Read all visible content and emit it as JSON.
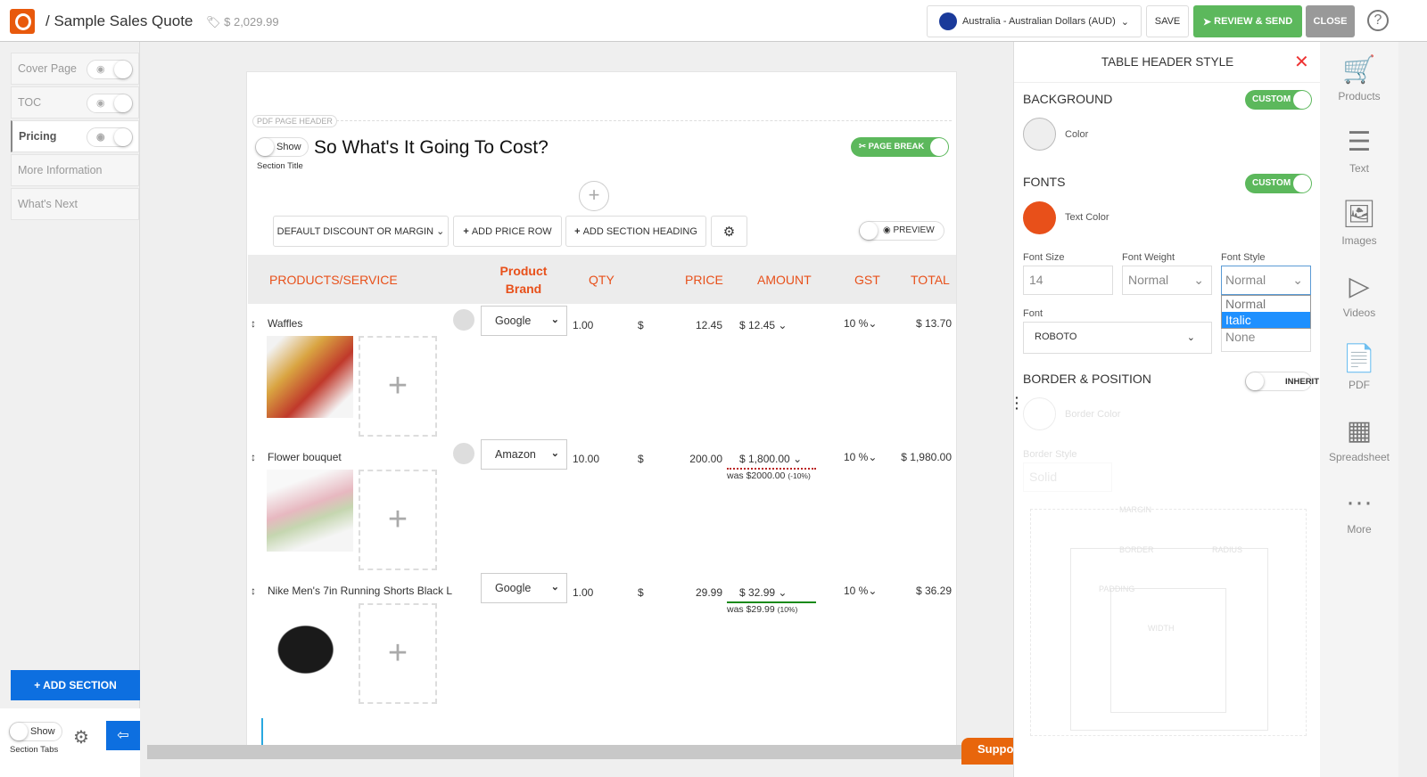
{
  "header": {
    "title": "/ Sample Sales Quote",
    "quote_total": "$ 2,029.99",
    "currency": "Australia - Australian Dollars (AUD)",
    "save": "SAVE",
    "review_send": "REVIEW & SEND",
    "close": "CLOSE",
    "help": "?"
  },
  "sidebar": {
    "items": [
      {
        "label": "Cover Page",
        "toggle": true
      },
      {
        "label": "TOC",
        "toggle": true
      },
      {
        "label": "Pricing",
        "toggle": true,
        "active": true
      },
      {
        "label": "More Information"
      },
      {
        "label": "What's Next"
      }
    ],
    "add_section": "+ ADD SECTION",
    "show": "Show",
    "section_tabs": "Section Tabs"
  },
  "page": {
    "pdf_header": "PDF PAGE HEADER",
    "show": "Show",
    "section_title_label": "Section Title",
    "section_title": "So What's It Going To Cost?",
    "page_break": "PAGE BREAK",
    "toolbar": {
      "discount": "DEFAULT DISCOUNT OR MARGIN",
      "add_price_row": "ADD PRICE ROW",
      "add_section_heading": "ADD SECTION HEADING",
      "preview": "PREVIEW"
    },
    "columns": [
      "PRODUCTS/SERVICE",
      "Product Brand",
      "QTY",
      "PRICE",
      "AMOUNT",
      "GST",
      "TOTAL"
    ],
    "rows": [
      {
        "name": "Waffles",
        "brand": "Google",
        "qty": "1.00",
        "cur": "$",
        "price": "12.45",
        "amount": "$ 12.45",
        "gst": "10 %",
        "total": "$ 13.70",
        "was": ""
      },
      {
        "name": "Flower bouquet",
        "brand": "Amazon",
        "qty": "10.00",
        "cur": "$",
        "price": "200.00",
        "amount": "$ 1,800.00",
        "gst": "10 %",
        "total": "$ 1,980.00",
        "was": "was $2000.00",
        "was_pct": "(-10%)"
      },
      {
        "name": "Nike Men's 7in Running Shorts Black L",
        "brand": "Google",
        "qty": "1.00",
        "cur": "$",
        "price": "29.99",
        "amount": "$ 32.99",
        "gst": "10 %",
        "total": "$ 36.29",
        "was": "was $29.99",
        "was_pct": "(10%)"
      }
    ],
    "support": "Suppo"
  },
  "panel": {
    "title": "TABLE HEADER STYLE",
    "background": "BACKGROUND",
    "custom": "CUSTOM",
    "color": "Color",
    "background_color": "#eeeeee",
    "fonts": "FONTS",
    "text_color": "Text Color",
    "text_color_value": "#e8501a",
    "font_size_label": "Font Size",
    "font_size": "14",
    "font_weight_label": "Font Weight",
    "font_weight": "Normal",
    "font_style_label": "Font Style",
    "font_style": "Normal",
    "font_style_options": [
      "Normal",
      "Italic"
    ],
    "font_style_highlighted": "Italic",
    "font_label": "Font",
    "font": "ROBOTO",
    "decoration": "None",
    "border_position": "BORDER & POSITION",
    "inherit": "INHERIT",
    "border_color": "Border Color",
    "border_style_label": "Border Style",
    "border_style": "Solid",
    "margin": "MARGIN",
    "border": "BORDER",
    "radius": "RADIUS",
    "padding": "PADDING",
    "width": "WIDTH"
  },
  "iconbar": [
    {
      "label": "Products",
      "icon": "cart-icon"
    },
    {
      "label": "Text",
      "icon": "lines-icon"
    },
    {
      "label": "Images",
      "icon": "image-icon"
    },
    {
      "label": "Videos",
      "icon": "play-icon"
    },
    {
      "label": "PDF",
      "icon": "pdf-icon"
    },
    {
      "label": "Spreadsheet",
      "icon": "grid-icon"
    },
    {
      "label": "More",
      "icon": "more-icon"
    }
  ]
}
